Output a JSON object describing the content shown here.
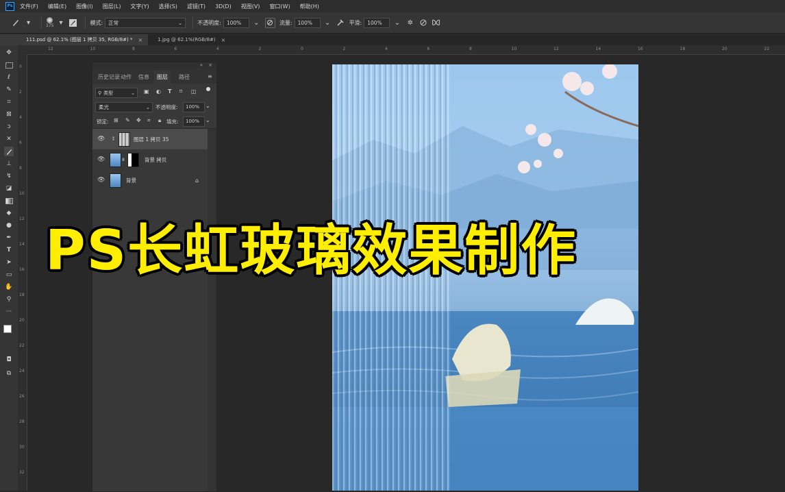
{
  "menu": {
    "items": [
      "文件(F)",
      "编辑(E)",
      "图像(I)",
      "图层(L)",
      "文字(Y)",
      "选择(S)",
      "滤镜(T)",
      "3D(D)",
      "视图(V)",
      "窗口(W)",
      "帮助(H)"
    ]
  },
  "options": {
    "brush_size": "175",
    "mode_label": "模式:",
    "mode_value": "正常",
    "opacity_label": "不透明度:",
    "opacity_value": "100%",
    "flow_label": "流量:",
    "flow_value": "100%",
    "smoothing_label": "平滑:",
    "smoothing_value": "100%"
  },
  "tabs": [
    {
      "label": "111.psd @ 62.1% (图层 1 拷贝 35, RGB/8#) *",
      "close": "×"
    },
    {
      "label": "1.jpg @ 62.1%(RGB/8#)",
      "close": "×"
    }
  ],
  "ruler": {
    "top": [
      "12",
      "10",
      "8",
      "6",
      "4",
      "2",
      "0",
      "2",
      "4",
      "6",
      "8",
      "10",
      "12",
      "14",
      "16",
      "18",
      "20",
      "22"
    ],
    "left": [
      "0",
      "2",
      "4",
      "6",
      "8",
      "10",
      "12",
      "14",
      "16",
      "18",
      "20",
      "22",
      "24",
      "26",
      "28",
      "30",
      "32"
    ]
  },
  "layers_panel": {
    "tabs": [
      "历史记录",
      "动作",
      "信息",
      "图层",
      "路径"
    ],
    "active_tab": "图层",
    "filter_label": "类型",
    "blend_mode": "柔光",
    "opacity_label": "不透明度:",
    "opacity_value": "100%",
    "lock_label": "锁定:",
    "fill_label": "填充:",
    "fill_value": "100%",
    "layers": [
      {
        "name": "图层 1 拷贝 35",
        "selected": true
      },
      {
        "name": "背景 拷贝",
        "selected": false
      },
      {
        "name": "背景",
        "selected": false
      }
    ]
  },
  "overlay": {
    "title": "PS长虹玻璃效果制作",
    "color": "#ffee00"
  },
  "colors": {
    "app_bg": "#282828",
    "panel_bg": "#383838",
    "accent": "#31a8ff"
  }
}
